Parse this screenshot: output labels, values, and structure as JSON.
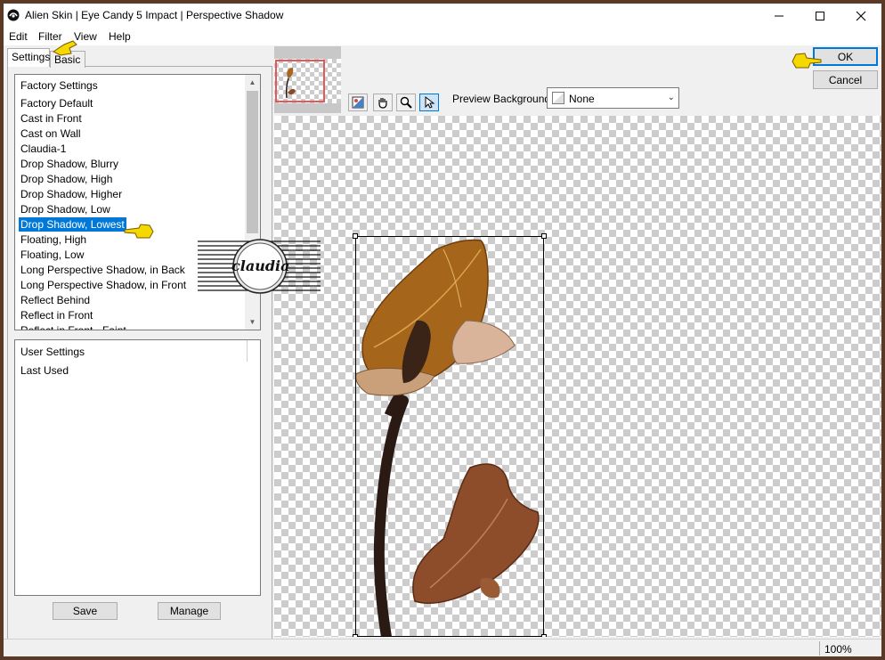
{
  "window": {
    "title": "Alien Skin | Eye Candy 5 Impact | Perspective Shadow",
    "min_icon": "minimize-icon",
    "max_icon": "maximize-icon",
    "close_icon": "close-icon"
  },
  "menu": [
    "Edit",
    "Filter",
    "View",
    "Help"
  ],
  "tabs": [
    "Settings",
    "Basic"
  ],
  "factory": {
    "header": "Factory Settings",
    "items": [
      "Factory Default",
      "Cast in Front",
      "Cast on Wall",
      "Claudia-1",
      "Drop Shadow, Blurry",
      "Drop Shadow, High",
      "Drop Shadow, Higher",
      "Drop Shadow, Low",
      "Drop Shadow, Lowest",
      "Floating, High",
      "Floating, Low",
      "Long Perspective Shadow, in Back",
      "Long Perspective Shadow, in Front",
      "Reflect Behind",
      "Reflect in Front",
      "Reflect in Front - Faint"
    ],
    "selected": "Drop Shadow, Lowest"
  },
  "user": {
    "header": "User Settings",
    "items": [
      "Last Used"
    ]
  },
  "buttons": {
    "save": "Save",
    "manage": "Manage",
    "ok": "OK",
    "cancel": "Cancel"
  },
  "preview": {
    "background_label": "Preview Background:",
    "background_value": "None"
  },
  "watermark": "claudia",
  "status": {
    "zoom": "100%"
  },
  "colors": {
    "selection": "#0078d7",
    "border": "#5a3a26",
    "pointer": "#f5d800"
  }
}
